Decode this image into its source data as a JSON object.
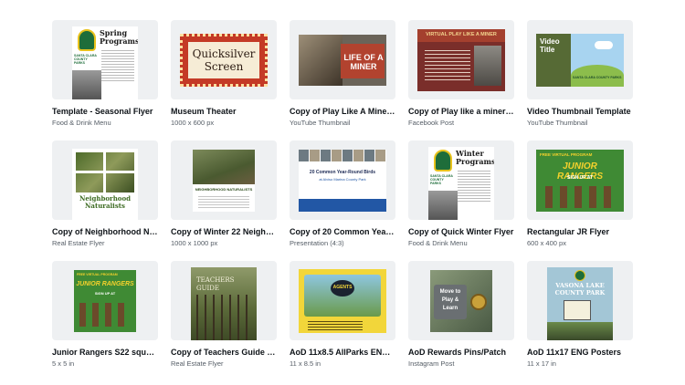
{
  "designs": [
    {
      "title": "Template - Seasonal Flyer",
      "subtitle": "Food & Drink Menu",
      "thumb": {
        "heading": "Spring Programs",
        "org": "SANTA CLARA COUNTY PARKS"
      }
    },
    {
      "title": "Museum Theater",
      "subtitle": "1000 x 600 px",
      "thumb": {
        "heading": "Quicksilver Screen"
      }
    },
    {
      "title": "Copy of Play Like A Miner T...",
      "subtitle": "YouTube Thumbnail",
      "thumb": {
        "heading": "LIFE OF A MINER"
      }
    },
    {
      "title": "Copy of Play like a miner vi...",
      "subtitle": "Facebook Post",
      "thumb": {
        "heading": "VIRTUAL PLAY LIKE A MINER"
      }
    },
    {
      "title": "Video Thumbnail Template",
      "subtitle": "YouTube Thumbnail",
      "thumb": {
        "heading": "Video Title",
        "org": "SANTA CLARA COUNTY PARKS"
      }
    },
    {
      "title": "Copy of Neighborhood Nat...",
      "subtitle": "Real Estate Flyer",
      "thumb": {
        "heading": "Neighborhood Naturalists"
      }
    },
    {
      "title": "Copy of Winter 22 Neighbo...",
      "subtitle": "1000 x 1000 px",
      "thumb": {
        "heading": "NEIGHBORHOOD NATURALISTS"
      }
    },
    {
      "title": "Copy of 20 Common Year-...",
      "subtitle": "Presentation (4:3)",
      "thumb": {
        "heading": "20 Common Year-Round Birds",
        "subheading": "at Alviso Marina County Park"
      }
    },
    {
      "title": "Copy of Quick Winter Flyer",
      "subtitle": "Food & Drink Menu",
      "thumb": {
        "heading": "Winter Programs",
        "org": "SANTA CLARA COUNTY PARKS"
      }
    },
    {
      "title": "Rectangular JR Flyer",
      "subtitle": "600 x 400 px",
      "thumb": {
        "tag": "FREE VIRTUAL PROGRAM",
        "heading": "JUNIOR RANGERS",
        "cta": "SIGN UP AT"
      }
    },
    {
      "title": "Junior Rangers S22 square ...",
      "subtitle": "5 x 5 in",
      "thumb": {
        "tag": "FREE VIRTUAL PROGRAM",
        "heading": "JUNIOR RANGERS",
        "cta": "SIGN UP AT"
      }
    },
    {
      "title": "Copy of Teachers Guide for...",
      "subtitle": "Real Estate Flyer",
      "thumb": {
        "heading": "TEACHERS GUIDE"
      }
    },
    {
      "title": "AoD 11x8.5 AllParks ENG/S...",
      "subtitle": "11 x 8.5 in",
      "thumb": {
        "heading": "AGENTS"
      }
    },
    {
      "title": "AoD Rewards Pins/Patch",
      "subtitle": "Instagram Post",
      "thumb": {
        "heading": "Move to Play & Learn"
      }
    },
    {
      "title": "AoD 11x17 ENG Posters",
      "subtitle": "11 x 17 in",
      "thumb": {
        "heading": "VASONA LAKE COUNTY PARK"
      }
    }
  ]
}
